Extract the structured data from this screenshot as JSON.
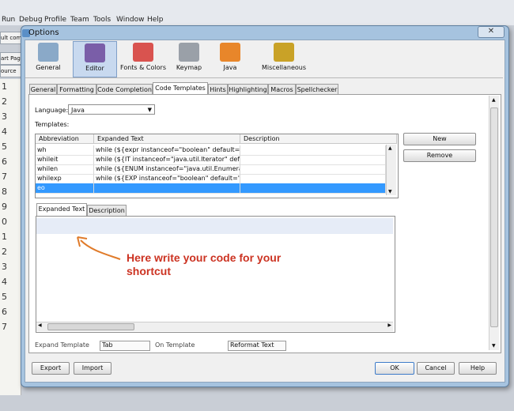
{
  "ide": {
    "menus": [
      "Run",
      "Debug",
      "Profile",
      "Team",
      "Tools",
      "Window",
      "Help"
    ],
    "side_tabs": [
      "ult com",
      "art Pag",
      "ource"
    ],
    "line_numbers": [
      "1",
      "2",
      "3",
      "4",
      "5",
      "6",
      "7",
      "8",
      "9",
      "0",
      "1",
      "2",
      "3",
      "4",
      "5",
      "6",
      "7"
    ]
  },
  "dialog": {
    "title": "Options",
    "close_glyph": "✕",
    "categories": [
      {
        "label": "General",
        "icon": "general-icon",
        "color": "#8aa9c8"
      },
      {
        "label": "Editor",
        "icon": "editor-icon",
        "color": "#7a5ea8",
        "selected": true
      },
      {
        "label": "Fonts & Colors",
        "icon": "fonts-colors-icon",
        "color": "#d9534f"
      },
      {
        "label": "Keymap",
        "icon": "keymap-icon",
        "color": "#9aa0a8"
      },
      {
        "label": "Java",
        "icon": "java-icon",
        "color": "#e8862a"
      },
      {
        "label": "Miscellaneous",
        "icon": "miscellaneous-icon",
        "color": "#c9a227"
      }
    ],
    "tabs": [
      "General",
      "Formatting",
      "Code Completion",
      "Code Templates",
      "Hints",
      "Highlighting",
      "Macros",
      "Spellchecker"
    ],
    "selected_tab": "Code Templates",
    "language_label": "Language:",
    "language_value": "Java",
    "templates_label": "Templates:",
    "table": {
      "headers": [
        "Abbreviation",
        "Expanded Text",
        "Description"
      ],
      "rows": [
        {
          "abbr": "wh",
          "text": "while (${expr instanceof=\"boolean\" default=\"t...",
          "desc": ""
        },
        {
          "abbr": "whileit",
          "text": "while (${IT instanceof=\"java.util.Iterator\" defa...",
          "desc": ""
        },
        {
          "abbr": "whilen",
          "text": "while (${ENUM instanceof=\"java.util.Enumerati...",
          "desc": ""
        },
        {
          "abbr": "whilexp",
          "text": "while (${EXP instanceof=\"boolean\" default=\"e...",
          "desc": ""
        },
        {
          "abbr": "eo",
          "text": "",
          "desc": "",
          "selected": true
        }
      ]
    },
    "new_button": "New",
    "remove_button": "Remove",
    "sub_tabs": [
      "Expanded Text",
      "Description"
    ],
    "annotation": "Here write your code for your shortcut",
    "cut_off_labels": [
      "Expand Template on:",
      "Tab",
      "On Template Expansion:",
      "Reformat Text"
    ],
    "export_button": "Export",
    "import_button": "Import",
    "ok_button": "OK",
    "cancel_button": "Cancel",
    "help_button": "Help"
  }
}
